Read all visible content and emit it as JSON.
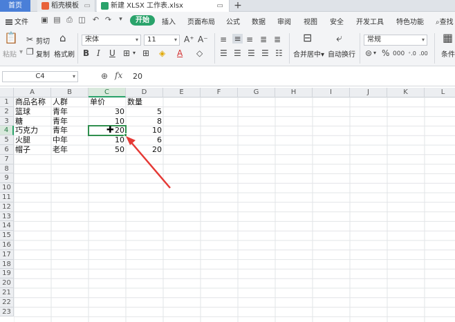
{
  "tabs": {
    "home": "首页",
    "template": "稻壳模板",
    "file": "新建 XLSX 工作表.xlsx"
  },
  "menu": {
    "file": "文件",
    "start": "开始",
    "items": [
      "插入",
      "页面布局",
      "公式",
      "数据",
      "审阅",
      "视图",
      "安全",
      "开发工具",
      "特色功能"
    ],
    "search": "查找"
  },
  "ribbon": {
    "paste": "粘贴",
    "cut": "剪切",
    "copy": "复制",
    "format_painter": "格式刷",
    "font_name": "宋体",
    "font_size": "11",
    "merge": "合并居中",
    "wrap": "自动换行",
    "number_format": "常规",
    "conditional": "条件"
  },
  "formula_bar": {
    "name_box": "C4",
    "fx": "fx",
    "value": "20"
  },
  "columns": [
    "A",
    "B",
    "C",
    "D",
    "E",
    "F",
    "G",
    "H",
    "I",
    "J",
    "K",
    "L"
  ],
  "selected_column": "C",
  "selected_row": 4,
  "rows": [
    [
      "商品名称",
      "人群",
      "单价",
      "数量"
    ],
    [
      "篮球",
      "青年",
      "30",
      "5"
    ],
    [
      "糖",
      "青年",
      "10",
      "8"
    ],
    [
      "巧克力",
      "青年",
      "20",
      "10"
    ],
    [
      "火腿",
      "中年",
      "10",
      "6"
    ],
    [
      "帽子",
      "老年",
      "50",
      "20"
    ]
  ],
  "total_rows": 23,
  "colors": {
    "accent": "#2aa36b",
    "home_tab": "#4a7fd8",
    "arrow": "#e53935"
  }
}
